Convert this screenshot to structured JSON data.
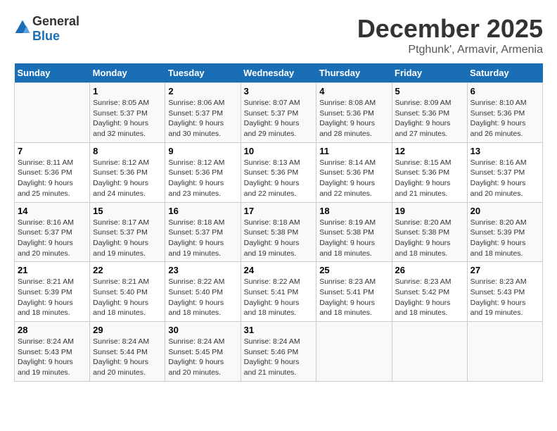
{
  "header": {
    "logo_general": "General",
    "logo_blue": "Blue",
    "title": "December 2025",
    "subtitle": "Ptghunk', Armavir, Armenia"
  },
  "calendar": {
    "days_of_week": [
      "Sunday",
      "Monday",
      "Tuesday",
      "Wednesday",
      "Thursday",
      "Friday",
      "Saturday"
    ],
    "weeks": [
      [
        {
          "day": "",
          "info": ""
        },
        {
          "day": "1",
          "info": "Sunrise: 8:05 AM\nSunset: 5:37 PM\nDaylight: 9 hours and 32 minutes."
        },
        {
          "day": "2",
          "info": "Sunrise: 8:06 AM\nSunset: 5:37 PM\nDaylight: 9 hours and 30 minutes."
        },
        {
          "day": "3",
          "info": "Sunrise: 8:07 AM\nSunset: 5:37 PM\nDaylight: 9 hours and 29 minutes."
        },
        {
          "day": "4",
          "info": "Sunrise: 8:08 AM\nSunset: 5:36 PM\nDaylight: 9 hours and 28 minutes."
        },
        {
          "day": "5",
          "info": "Sunrise: 8:09 AM\nSunset: 5:36 PM\nDaylight: 9 hours and 27 minutes."
        },
        {
          "day": "6",
          "info": "Sunrise: 8:10 AM\nSunset: 5:36 PM\nDaylight: 9 hours and 26 minutes."
        }
      ],
      [
        {
          "day": "7",
          "info": "Sunrise: 8:11 AM\nSunset: 5:36 PM\nDaylight: 9 hours and 25 minutes."
        },
        {
          "day": "8",
          "info": "Sunrise: 8:12 AM\nSunset: 5:36 PM\nDaylight: 9 hours and 24 minutes."
        },
        {
          "day": "9",
          "info": "Sunrise: 8:12 AM\nSunset: 5:36 PM\nDaylight: 9 hours and 23 minutes."
        },
        {
          "day": "10",
          "info": "Sunrise: 8:13 AM\nSunset: 5:36 PM\nDaylight: 9 hours and 22 minutes."
        },
        {
          "day": "11",
          "info": "Sunrise: 8:14 AM\nSunset: 5:36 PM\nDaylight: 9 hours and 22 minutes."
        },
        {
          "day": "12",
          "info": "Sunrise: 8:15 AM\nSunset: 5:36 PM\nDaylight: 9 hours and 21 minutes."
        },
        {
          "day": "13",
          "info": "Sunrise: 8:16 AM\nSunset: 5:37 PM\nDaylight: 9 hours and 20 minutes."
        }
      ],
      [
        {
          "day": "14",
          "info": "Sunrise: 8:16 AM\nSunset: 5:37 PM\nDaylight: 9 hours and 20 minutes."
        },
        {
          "day": "15",
          "info": "Sunrise: 8:17 AM\nSunset: 5:37 PM\nDaylight: 9 hours and 19 minutes."
        },
        {
          "day": "16",
          "info": "Sunrise: 8:18 AM\nSunset: 5:37 PM\nDaylight: 9 hours and 19 minutes."
        },
        {
          "day": "17",
          "info": "Sunrise: 8:18 AM\nSunset: 5:38 PM\nDaylight: 9 hours and 19 minutes."
        },
        {
          "day": "18",
          "info": "Sunrise: 8:19 AM\nSunset: 5:38 PM\nDaylight: 9 hours and 18 minutes."
        },
        {
          "day": "19",
          "info": "Sunrise: 8:20 AM\nSunset: 5:38 PM\nDaylight: 9 hours and 18 minutes."
        },
        {
          "day": "20",
          "info": "Sunrise: 8:20 AM\nSunset: 5:39 PM\nDaylight: 9 hours and 18 minutes."
        }
      ],
      [
        {
          "day": "21",
          "info": "Sunrise: 8:21 AM\nSunset: 5:39 PM\nDaylight: 9 hours and 18 minutes."
        },
        {
          "day": "22",
          "info": "Sunrise: 8:21 AM\nSunset: 5:40 PM\nDaylight: 9 hours and 18 minutes."
        },
        {
          "day": "23",
          "info": "Sunrise: 8:22 AM\nSunset: 5:40 PM\nDaylight: 9 hours and 18 minutes."
        },
        {
          "day": "24",
          "info": "Sunrise: 8:22 AM\nSunset: 5:41 PM\nDaylight: 9 hours and 18 minutes."
        },
        {
          "day": "25",
          "info": "Sunrise: 8:23 AM\nSunset: 5:41 PM\nDaylight: 9 hours and 18 minutes."
        },
        {
          "day": "26",
          "info": "Sunrise: 8:23 AM\nSunset: 5:42 PM\nDaylight: 9 hours and 18 minutes."
        },
        {
          "day": "27",
          "info": "Sunrise: 8:23 AM\nSunset: 5:43 PM\nDaylight: 9 hours and 19 minutes."
        }
      ],
      [
        {
          "day": "28",
          "info": "Sunrise: 8:24 AM\nSunset: 5:43 PM\nDaylight: 9 hours and 19 minutes."
        },
        {
          "day": "29",
          "info": "Sunrise: 8:24 AM\nSunset: 5:44 PM\nDaylight: 9 hours and 20 minutes."
        },
        {
          "day": "30",
          "info": "Sunrise: 8:24 AM\nSunset: 5:45 PM\nDaylight: 9 hours and 20 minutes."
        },
        {
          "day": "31",
          "info": "Sunrise: 8:24 AM\nSunset: 5:46 PM\nDaylight: 9 hours and 21 minutes."
        },
        {
          "day": "",
          "info": ""
        },
        {
          "day": "",
          "info": ""
        },
        {
          "day": "",
          "info": ""
        }
      ]
    ]
  }
}
